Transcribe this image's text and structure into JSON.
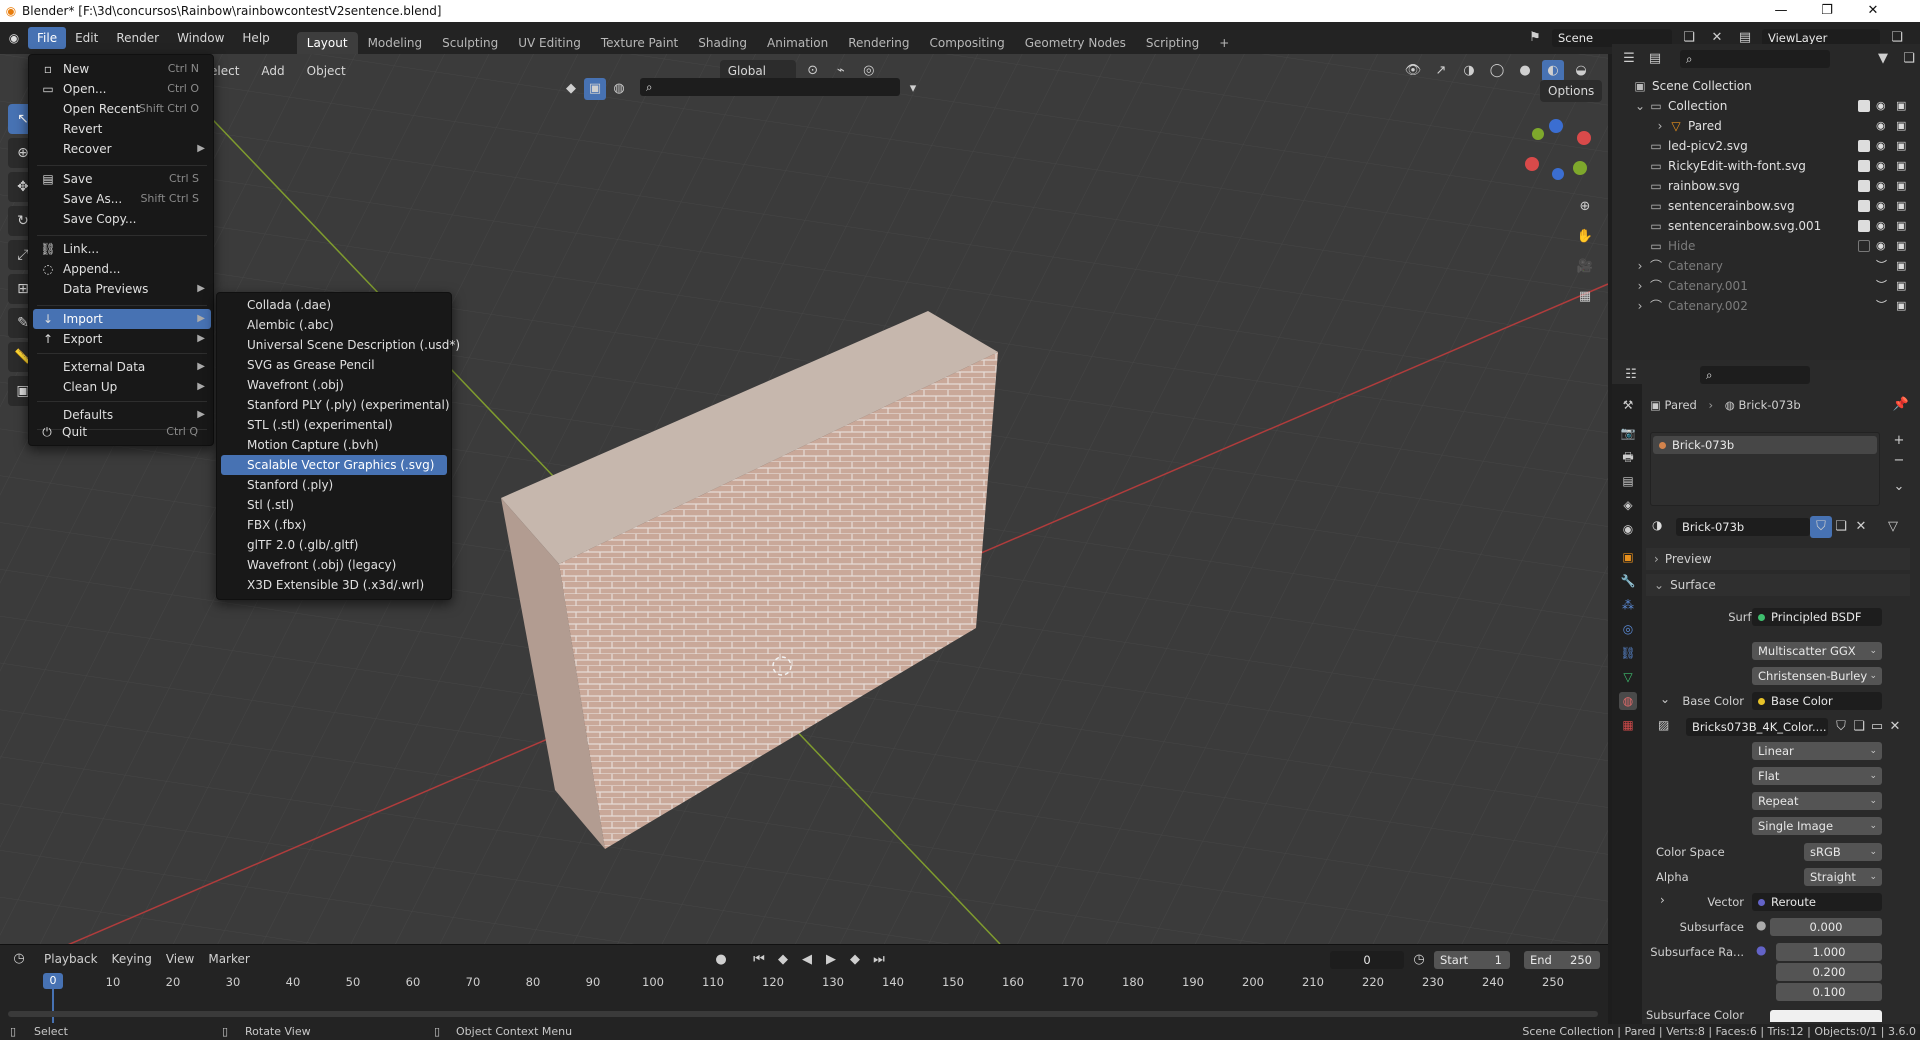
{
  "window": {
    "title": "Blender* [F:\\3d\\concursos\\Rainbow\\rainbowcontestV2sentence.blend]"
  },
  "topmenu": [
    {
      "label": "File",
      "active": true
    },
    {
      "label": "Edit"
    },
    {
      "label": "Render"
    },
    {
      "label": "Window"
    },
    {
      "label": "Help"
    }
  ],
  "workspaces": [
    "Layout",
    "Modeling",
    "Sculpting",
    "UV Editing",
    "Texture Paint",
    "Shading",
    "Animation",
    "Rendering",
    "Compositing",
    "Geometry Nodes",
    "Scripting"
  ],
  "scene": {
    "name": "Scene",
    "viewlayer": "ViewLayer"
  },
  "viewport_header": {
    "select": "elect",
    "add": "Add",
    "object": "Object",
    "orientation": "Global",
    "options": "Options"
  },
  "file_menu": [
    {
      "label": "New",
      "shortcut": "Ctrl N",
      "icon": "document-icon",
      "submenu": true
    },
    {
      "label": "Open...",
      "shortcut": "Ctrl O",
      "icon": "folder-icon"
    },
    {
      "label": "Open Recent",
      "shortcut": "Shift Ctrl O",
      "submenu": true
    },
    {
      "label": "Revert"
    },
    {
      "label": "Recover",
      "submenu": true
    },
    {
      "label": "Save",
      "shortcut": "Ctrl S",
      "icon": "save-icon"
    },
    {
      "label": "Save As...",
      "shortcut": "Shift Ctrl S"
    },
    {
      "label": "Save Copy..."
    },
    {
      "label": "Link...",
      "icon": "link-icon"
    },
    {
      "label": "Append...",
      "icon": "append-icon"
    },
    {
      "label": "Data Previews",
      "submenu": true
    },
    {
      "label": "Import",
      "icon": "import-icon",
      "submenu": true,
      "highlighted": true
    },
    {
      "label": "Export",
      "icon": "export-icon",
      "submenu": true
    },
    {
      "label": "External Data",
      "submenu": true
    },
    {
      "label": "Clean Up",
      "submenu": true
    },
    {
      "label": "Defaults",
      "submenu": true
    },
    {
      "label": "Quit",
      "shortcut": "Ctrl Q",
      "icon": "power-icon"
    }
  ],
  "import_menu": [
    "Collada (.dae)",
    "Alembic (.abc)",
    "Universal Scene Description (.usd*)",
    "SVG as Grease Pencil",
    "Wavefront (.obj)",
    "Stanford PLY (.ply) (experimental)",
    "STL (.stl) (experimental)",
    "Motion Capture (.bvh)",
    "Scalable Vector Graphics (.svg)",
    "Stanford (.ply)",
    "Stl (.stl)",
    "FBX (.fbx)",
    "glTF 2.0 (.glb/.gltf)",
    "Wavefront (.obj) (legacy)",
    "X3D Extensible 3D (.x3d/.wrl)"
  ],
  "import_highlighted": "Scalable Vector Graphics (.svg)",
  "outliner": {
    "root": "Scene Collection",
    "rows": [
      {
        "name": "Collection",
        "indent": 1,
        "checked": true
      },
      {
        "name": "Pared",
        "indent": 2,
        "checked": null
      },
      {
        "name": "led-picv2.svg",
        "indent": 1,
        "checked": true
      },
      {
        "name": "RickyEdit-with-font.svg",
        "indent": 1,
        "checked": true
      },
      {
        "name": "rainbow.svg",
        "indent": 1,
        "checked": true
      },
      {
        "name": "sentencerainbow.svg",
        "indent": 1,
        "checked": true
      },
      {
        "name": "sentencerainbow.svg.001",
        "indent": 1,
        "checked": true
      },
      {
        "name": "Hide",
        "indent": 1,
        "checked": false,
        "dim": true
      },
      {
        "name": "Catenary",
        "indent": 1,
        "dim": true
      },
      {
        "name": "Catenary.001",
        "indent": 1,
        "dim": true
      },
      {
        "name": "Catenary.002",
        "indent": 1,
        "dim": true
      }
    ]
  },
  "properties": {
    "breadcrumb_object": "Pared",
    "breadcrumb_material": "Brick-073b",
    "slot": "Brick-073b",
    "material_name": "Brick-073b",
    "preview_label": "Preview",
    "surface_label": "Surface",
    "surface_field_label": "Surface",
    "surface_value": "Principled BSDF",
    "distribution": "Multiscatter GGX",
    "subsurface_method": "Christensen-Burley",
    "base_color_label": "Base Color",
    "base_color_value": "Base Color",
    "image_name": "Bricks073B_4K_Color....",
    "interpolation": "Linear",
    "projection": "Flat",
    "extension": "Repeat",
    "source": "Single Image",
    "color_space_label": "Color Space",
    "color_space": "sRGB",
    "alpha_label": "Alpha",
    "alpha": "Straight",
    "vector_label": "Vector",
    "vector_value": "Reroute",
    "subsurface_label": "Subsurface",
    "subsurface": "0.000",
    "subsurface_radius_label": "Subsurface Ra...",
    "subsurface_radius": [
      "1.000",
      "0.200",
      "0.100"
    ],
    "subsurface_color_label": "Subsurface Color"
  },
  "timeline": {
    "menus": [
      "Playback",
      "Keying",
      "View",
      "Marker"
    ],
    "current_frame": "0",
    "start_label": "Start",
    "start": "1",
    "end_label": "End",
    "end": "250",
    "ticks": [
      "0",
      "10",
      "20",
      "30",
      "40",
      "50",
      "60",
      "70",
      "80",
      "90",
      "100",
      "110",
      "120",
      "130",
      "140",
      "150",
      "160",
      "170",
      "180",
      "190",
      "200",
      "210",
      "220",
      "230",
      "240",
      "250"
    ],
    "playhead_frame": "0"
  },
  "status": {
    "select": "Select",
    "rotate": "Rotate View",
    "context": "Object Context Menu",
    "stats": "Scene Collection | Pared | Verts:8 | Faces:6 | Tris:12 | Objects:0/1 | 3.6.0"
  }
}
